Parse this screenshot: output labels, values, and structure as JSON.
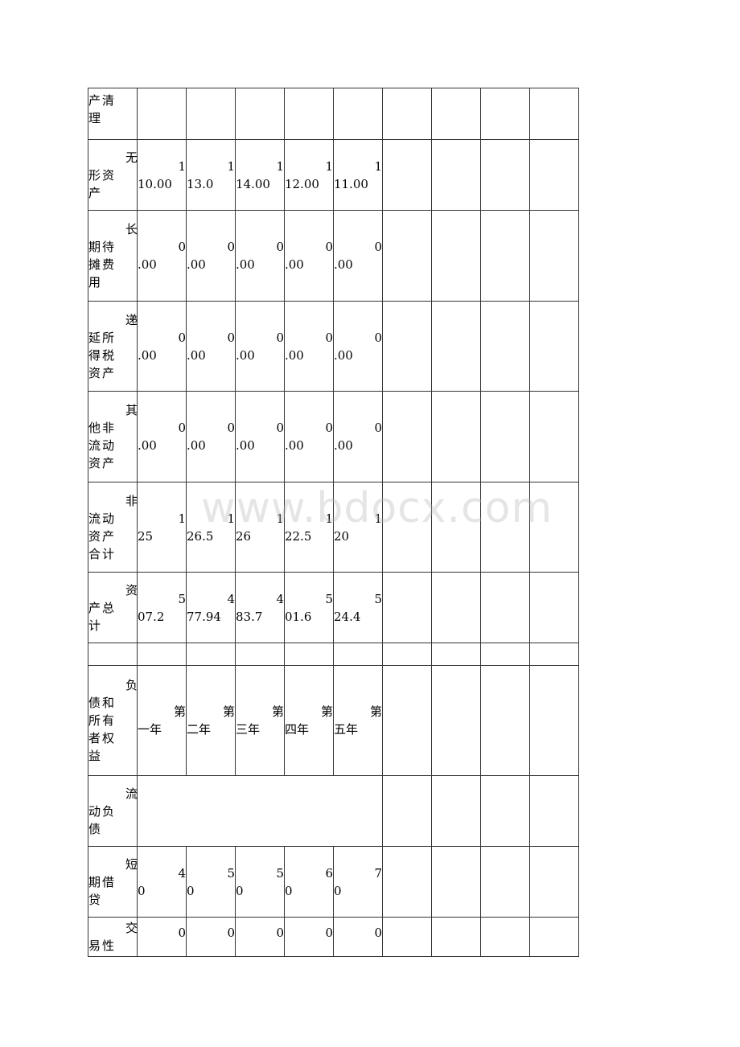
{
  "watermark": "www.bdocx.com",
  "rows": [
    {
      "label_first": "",
      "label_rest": "产清理",
      "cells": [
        "",
        "",
        "",
        "",
        ""
      ],
      "blank_extra": 4
    },
    {
      "label_first": "无",
      "label_rest": "形资产",
      "cells": [
        [
          "1",
          "10.00"
        ],
        [
          "1",
          "13.0"
        ],
        [
          "1",
          "14.00"
        ],
        [
          "1",
          "12.00"
        ],
        [
          "1",
          "11.00"
        ]
      ]
    },
    {
      "label_first": "长",
      "label_rest": "期待摊费用",
      "cells": [
        [
          "0",
          ".00"
        ],
        [
          "0",
          ".00"
        ],
        [
          "0",
          ".00"
        ],
        [
          "0",
          ".00"
        ],
        [
          "0",
          ".00"
        ]
      ]
    },
    {
      "label_first": "递",
      "label_rest": "延所得税资产",
      "cells": [
        [
          "0",
          ".00"
        ],
        [
          "0",
          ".00"
        ],
        [
          "0",
          ".00"
        ],
        [
          "0",
          ".00"
        ],
        [
          "0",
          ".00"
        ]
      ]
    },
    {
      "label_first": "其",
      "label_rest": "他非流动资产",
      "cells": [
        [
          "0",
          ".00"
        ],
        [
          "0",
          ".00"
        ],
        [
          "0",
          ".00"
        ],
        [
          "0",
          ".00"
        ],
        [
          "0",
          ".00"
        ]
      ]
    },
    {
      "label_first": "非",
      "label_rest": "流动资产合计",
      "cells": [
        [
          "1",
          "25"
        ],
        [
          "1",
          "26.5"
        ],
        [
          "1",
          "26"
        ],
        [
          "1",
          "22.5"
        ],
        [
          "1",
          "20"
        ]
      ]
    },
    {
      "label_first": "资",
      "label_rest": "产总计",
      "cells": [
        [
          "5",
          "07.2"
        ],
        [
          "4",
          "77.94"
        ],
        [
          "4",
          "83.7"
        ],
        [
          "5",
          "01.6"
        ],
        [
          "5",
          "24.4"
        ]
      ]
    },
    {
      "label_first": "",
      "label_rest": "",
      "cells": [
        "",
        "",
        "",
        "",
        ""
      ]
    },
    {
      "label_first": "负",
      "label_rest": "债和所有者权益",
      "cells": [
        [
          "第",
          "一年"
        ],
        [
          "第",
          "二年"
        ],
        [
          "第",
          "三年"
        ],
        [
          "第",
          "四年"
        ],
        [
          "第",
          "五年"
        ]
      ]
    },
    {
      "label_first": "流",
      "label_rest": "动负债",
      "merged": true
    },
    {
      "label_first": "短",
      "label_rest": "期借贷",
      "cells": [
        [
          "4",
          "0"
        ],
        [
          "5",
          "0"
        ],
        [
          "5",
          "0"
        ],
        [
          "6",
          "0"
        ],
        [
          "7",
          "0"
        ]
      ]
    },
    {
      "label_first": "交",
      "label_rest": "易性",
      "cells": [
        [
          "0",
          ""
        ],
        [
          "0",
          ""
        ],
        [
          "0",
          ""
        ],
        [
          "0",
          ""
        ],
        [
          "0",
          ""
        ]
      ]
    }
  ],
  "table": {
    "r0": {
      "label": "产清理"
    },
    "r1": {
      "label_first": "无",
      "label_rest": "形资产",
      "v": [
        [
          "1",
          "10.00"
        ],
        [
          "1",
          "13.0"
        ],
        [
          "1",
          "14.00"
        ],
        [
          "1",
          "12.00"
        ],
        [
          "1",
          "11.00"
        ]
      ]
    },
    "r2": {
      "label_first": "长",
      "label_rest": "期待摊费用",
      "v": [
        [
          "0",
          ".00"
        ],
        [
          "0",
          ".00"
        ],
        [
          "0",
          ".00"
        ],
        [
          "0",
          ".00"
        ],
        [
          "0",
          ".00"
        ]
      ]
    },
    "r3": {
      "label_first": "递",
      "label_rest": "延所得税资产",
      "v": [
        [
          "0",
          ".00"
        ],
        [
          "0",
          ".00"
        ],
        [
          "0",
          ".00"
        ],
        [
          "0",
          ".00"
        ],
        [
          "0",
          ".00"
        ]
      ]
    },
    "r4": {
      "label_first": "其",
      "label_rest": "他非流动资产",
      "v": [
        [
          "0",
          ".00"
        ],
        [
          "0",
          ".00"
        ],
        [
          "0",
          ".00"
        ],
        [
          "0",
          ".00"
        ],
        [
          "0",
          ".00"
        ]
      ]
    },
    "r5": {
      "label_first": "非",
      "label_rest": "流动资产合计",
      "v": [
        [
          "1",
          "25"
        ],
        [
          "1",
          "26.5"
        ],
        [
          "1",
          "26"
        ],
        [
          "1",
          "22.5"
        ],
        [
          "1",
          "20"
        ]
      ]
    },
    "r6": {
      "label_first": "资",
      "label_rest": "产总计",
      "v": [
        [
          "5",
          "07.2"
        ],
        [
          "4",
          "77.94"
        ],
        [
          "4",
          "83.7"
        ],
        [
          "5",
          "01.6"
        ],
        [
          "5",
          "24.4"
        ]
      ]
    },
    "r8": {
      "label_first": "负",
      "label_rest": "债和所有者权益",
      "v": [
        [
          "第",
          "一年"
        ],
        [
          "第",
          "二年"
        ],
        [
          "第",
          "三年"
        ],
        [
          "第",
          "四年"
        ],
        [
          "第",
          "五年"
        ]
      ]
    },
    "r9": {
      "label_first": "流",
      "label_rest": "动负债"
    },
    "r10": {
      "label_first": "短",
      "label_rest": "期借贷",
      "v": [
        [
          "4",
          "0"
        ],
        [
          "5",
          "0"
        ],
        [
          "5",
          "0"
        ],
        [
          "6",
          "0"
        ],
        [
          "7",
          "0"
        ]
      ]
    },
    "r11": {
      "label_first": "交",
      "label_rest": "易性",
      "v": [
        [
          "0",
          ""
        ],
        [
          "0",
          ""
        ],
        [
          "0",
          ""
        ],
        [
          "0",
          ""
        ],
        [
          "0",
          ""
        ]
      ]
    }
  }
}
